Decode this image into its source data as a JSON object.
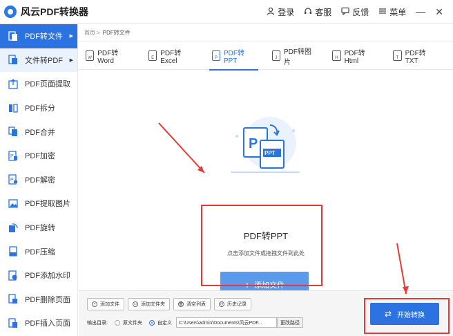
{
  "app": {
    "title": "风云PDF转换器"
  },
  "title_actions": [
    {
      "label": "登录",
      "icon": "user-icon"
    },
    {
      "label": "客服",
      "icon": "headset-icon"
    },
    {
      "label": "反馈",
      "icon": "feedback-icon"
    },
    {
      "label": "菜单",
      "icon": "menu-icon"
    }
  ],
  "sidebar": {
    "items": [
      {
        "label": "PDF转文件",
        "icon": "pdf-convert-icon"
      },
      {
        "label": "文件转PDF",
        "icon": "file-to-pdf-icon"
      },
      {
        "label": "PDF页面提取",
        "icon": "page-extract-icon"
      },
      {
        "label": "PDF拆分",
        "icon": "split-icon"
      },
      {
        "label": "PDF合并",
        "icon": "merge-icon"
      },
      {
        "label": "PDF加密",
        "icon": "encrypt-icon"
      },
      {
        "label": "PDF解密",
        "icon": "decrypt-icon"
      },
      {
        "label": "PDF提取图片",
        "icon": "extract-image-icon"
      },
      {
        "label": "PDF旋转",
        "icon": "rotate-icon"
      },
      {
        "label": "PDF压缩",
        "icon": "compress-icon"
      },
      {
        "label": "PDF添加水印",
        "icon": "watermark-icon"
      },
      {
        "label": "PDF删除页面",
        "icon": "delete-page-icon"
      },
      {
        "label": "PDF插入页面",
        "icon": "insert-page-icon"
      }
    ]
  },
  "breadcrumb": {
    "home": "首页",
    "sep": ">",
    "current": "PDF转文件"
  },
  "tabs": [
    {
      "label": "PDF转Word",
      "glyph": "W"
    },
    {
      "label": "PDF转Excel",
      "glyph": "E"
    },
    {
      "label": "PDF转PPT",
      "glyph": "P"
    },
    {
      "label": "PDF转图片",
      "glyph": "J"
    },
    {
      "label": "PDF转Html",
      "glyph": "H"
    },
    {
      "label": "PDF转TXT",
      "glyph": "T"
    }
  ],
  "drop_area": {
    "title": "PDF转PPT",
    "hint": "点击添加文件或拖拽文件到此处",
    "add_button": "添加文件",
    "illustration": {
      "letter": "P",
      "badge": "PPT"
    }
  },
  "toolbar": {
    "buttons": [
      {
        "label": "添加文件",
        "glyph": "+"
      },
      {
        "label": "添加文件夹",
        "glyph": "▭"
      },
      {
        "label": "清空列表",
        "glyph": "🗑"
      },
      {
        "label": "历史记录",
        "glyph": "◷"
      }
    ]
  },
  "output": {
    "label": "输出目录:",
    "option_source": "原文件夹",
    "option_custom": "自定义",
    "selected": "自定义",
    "path": "C:\\Users\\admin\\Documents\\风云PDF...",
    "change_button": "更改路径"
  },
  "start_button": "开始转换",
  "colors": {
    "accent": "#2a73e0",
    "annotation": "#e53935",
    "add_button": "#5b9ae9"
  }
}
